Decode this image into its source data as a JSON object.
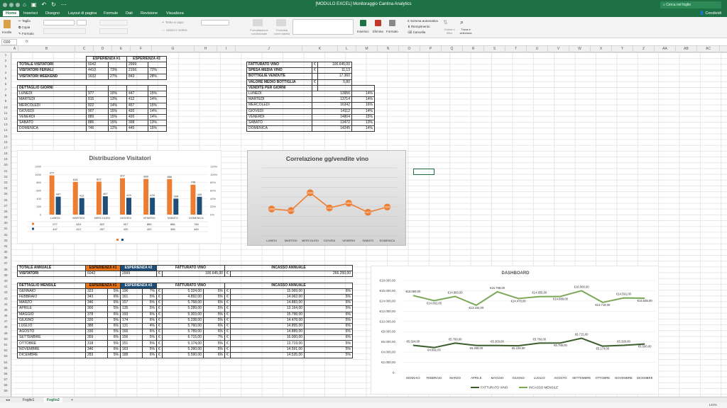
{
  "window": {
    "title": "[MODULO EXCEL] Monitoraggio Cantina Analytics",
    "search_placeholder": "Cerca nel foglio",
    "share_label": "Condividi"
  },
  "ribbon_tabs": [
    "Home",
    "Inserisci",
    "Disegno",
    "Layout di pagina",
    "Formule",
    "Dati",
    "Revisione",
    "Visualizza"
  ],
  "ribbon": {
    "paste": "Incolla",
    "cut": "Taglia",
    "copy": "Copia",
    "format_painter": "Formato",
    "wrap_text": "Testo a capo",
    "merge_center": "Unisci e centra",
    "conditional_format": "Formattazione condizionale",
    "format_as_table": "Formatta come tabella",
    "insert": "Inserisci",
    "delete": "Elimina",
    "format": "Formato",
    "autosum": "Somma automatica",
    "fill": "Riempimento",
    "clear": "Cancella",
    "sort_filter": "Ordina e filtra",
    "find_select": "Trova e seleziona"
  },
  "formula_bar": {
    "cell": "O20",
    "fx": "fx"
  },
  "columns": [
    "A",
    "B",
    "C",
    "D",
    "E",
    "F",
    "G",
    "H",
    "I",
    "J",
    "K",
    "L",
    "M",
    "N",
    "O",
    "P",
    "Q",
    "R",
    "S",
    "T",
    "U",
    "V",
    "W",
    "X",
    "Y",
    "Z",
    "AA",
    "AB",
    "AC"
  ],
  "visitor_table": {
    "h1": "ESPERIENZA #1",
    "h2": "ESPERIENZA #2",
    "totale": "TOTALE VISITATORI",
    "tot1": "6042",
    "tot2": "2999",
    "feriali": "VISITATORI FERIALI",
    "fer1": "4410",
    "fer1p": "73%",
    "fer2": "2156",
    "fer2p": "72%",
    "weekend": "VISITATORI WEEKEND",
    "wk1": "1632",
    "wk1p": "27%",
    "wk2": "843",
    "wk2p": "28%",
    "dettaglio": "DETTAGLIO GIORNI",
    "days": [
      [
        "LUNEDI",
        "977",
        "16%",
        "447",
        "15%"
      ],
      [
        "MARTEDI",
        "815",
        "13%",
        "412",
        "14%"
      ],
      [
        "MERCOLEDI",
        "822",
        "14%",
        "457",
        "15%"
      ],
      [
        "GIOVEDI",
        "907",
        "15%",
        "420",
        "14%"
      ],
      [
        "VENERDI",
        "889",
        "15%",
        "420",
        "14%"
      ],
      [
        "SABATO",
        "886",
        "15%",
        "398",
        "13%"
      ],
      [
        "DOMENICA",
        "746",
        "12%",
        "445",
        "15%"
      ]
    ]
  },
  "wine_table": {
    "fatturato": "FATTURATO VINO",
    "fatturato_cur": "€",
    "fatturato_val": "100.645,00",
    "spesa": "SPESA MEDIA VINO",
    "spesa_cur": "€",
    "spesa_val": "11,13",
    "bottiglie": "BOTTIGLIE VENDUTE",
    "bottiglie_val": "17.360",
    "valore": "VALORE MEDIO BOTTIGLIA",
    "valore_cur": "€",
    "valore_val": "5,80",
    "vendite": "VENDITE PER GIORNI",
    "days": [
      [
        "LUNEDI",
        "13956",
        "14%"
      ],
      [
        "MARTEDI",
        "13714",
        "14%"
      ],
      [
        "MERCOLEDI",
        "16342",
        "16%"
      ],
      [
        "GIOVEDI",
        "14112",
        "14%"
      ],
      [
        "VENERDI",
        "14804",
        "15%"
      ],
      [
        "SABATO",
        "13472",
        "13%"
      ],
      [
        "DOMENICA",
        "14245",
        "14%"
      ]
    ]
  },
  "annual_table": {
    "totale": "TOTALE ANNUALE",
    "esp1": "ESPERIENZA #1",
    "esp2": "ESPERIENZA #2",
    "fatturato": "FATTURATO VINO",
    "incasso": "INCASSO ANNUALE",
    "visitatori": "VISITATORI",
    "v1": "6042",
    "v2": "2999",
    "cur": "€",
    "fatt_val": "100.645,00",
    "inc_val": "266.250,00",
    "dettaglio": "DETTAGLIO MENSILE",
    "months": [
      [
        "GENNAIO",
        "323",
        "5%",
        "196",
        "7%",
        "5.324,00",
        "5%",
        "15.069,00",
        "6%"
      ],
      [
        "FEBBRAIO",
        "343",
        "6%",
        "161",
        "5%",
        "4.892,00",
        "5%",
        "14.062,00",
        "5%"
      ],
      [
        "MARZO",
        "346",
        "6%",
        "157",
        "5%",
        "5.768,00",
        "6%",
        "14.883,00",
        "6%"
      ],
      [
        "APRILE",
        "300",
        "5%",
        "135",
        "5%",
        "5.289,00",
        "5%",
        "13.164,00",
        "5%"
      ],
      [
        "MAGGIO",
        "378",
        "6%",
        "193",
        "6%",
        "5.303,00",
        "5%",
        "15.798,00",
        "6%"
      ],
      [
        "GIUGNO",
        "326",
        "5%",
        "174",
        "6%",
        "5.238,00",
        "5%",
        "14.478,00",
        "5%"
      ],
      [
        "LUGLIO",
        "388",
        "6%",
        "131",
        "4%",
        "5.760,00",
        "6%",
        "14.855,00",
        "6%"
      ],
      [
        "AGOSTO",
        "330",
        "5%",
        "166",
        "6%",
        "5.789,00",
        "6%",
        "14.889,00",
        "6%"
      ],
      [
        "SETTEMBRE",
        "359",
        "6%",
        "156",
        "5%",
        "6.715,00",
        "7%",
        "16.000,00",
        "6%"
      ],
      [
        "OTTOBRE",
        "318",
        "5%",
        "151",
        "5%",
        "5.174,00",
        "5%",
        "13.719,00",
        "5%"
      ],
      [
        "NOVEMBRE",
        "346",
        "6%",
        "163",
        "5%",
        "5.390,00",
        "5%",
        "14.591,00",
        "5%"
      ],
      [
        "DICEMBRE",
        "283",
        "5%",
        "188",
        "6%",
        "5.590,00",
        "6%",
        "14.535,00",
        "5%"
      ]
    ]
  },
  "chart_data": [
    {
      "type": "bar",
      "title": "Distribuzione Visitatori",
      "categories": [
        "LUNEDI",
        "MARTEDI",
        "MERCOLEDI",
        "GIOVEDI",
        "VENERDI",
        "SABATO",
        "DOMENICA"
      ],
      "series": [
        {
          "values": [
            977,
            815,
            822,
            907,
            889,
            886,
            746
          ],
          "color": "#ed7d31"
        },
        {
          "values": [
            447,
            412,
            457,
            420,
            420,
            398,
            445
          ],
          "color": "#1f4e79"
        }
      ],
      "ylim": [
        0,
        1200
      ],
      "yticks": [
        "0",
        "200",
        "400",
        "600",
        "800",
        "1000",
        "1200"
      ],
      "y2ticks": [
        "0%",
        "20%",
        "40%",
        "60%",
        "80%",
        "100%",
        "120%"
      ],
      "grid": true,
      "data_table": true
    },
    {
      "type": "line",
      "title": "Correlazione gg/vendite vino",
      "categories": [
        "LUNEDI",
        "MARTEDI",
        "MERCOLEDI",
        "GIOVEDI",
        "VENERDI",
        "SABATO",
        "DOMENICA"
      ],
      "series": [
        {
          "values": [
            13956,
            13714,
            16342,
            14112,
            14804,
            13472,
            14245
          ],
          "labels": [
            "13956",
            "13714",
            "16342",
            "14112",
            "14804",
            "13472",
            "14245"
          ],
          "color": "#ed7d31"
        }
      ],
      "grid": true
    },
    {
      "type": "line",
      "title": "DASHBOARD",
      "categories": [
        "GENNAIO",
        "FEBBRAIO",
        "MARZO",
        "APRILE",
        "MAGGIO",
        "GIUGNO",
        "LUGLIO",
        "AGOSTO",
        "SETTEMBRE",
        "OTTOBRE",
        "NOVEMBRE",
        "DICEMBRE"
      ],
      "series": [
        {
          "name": "FATTURATO VINO",
          "values": [
            5324,
            4892,
            5768,
            5289,
            5303,
            5238,
            5760,
            5789,
            6715,
            5174,
            5326,
            5590
          ],
          "labels": [
            "€5.324,00",
            "€4.892,00",
            "€5.768,00",
            "€5.289,00",
            "€5.303,00",
            "€5.238,00",
            "€5.760,00",
            "€5.789,00",
            "€6.715,00",
            "€5.174,00",
            "€5.326,00",
            "€5.590,00"
          ],
          "color": "#3b5e2b"
        },
        {
          "name": "INCASSO MENSILE",
          "values": [
            15069,
            14062,
            14883,
            13164,
            15798,
            14478,
            14855,
            14889,
            16000,
            13719,
            14591,
            14535
          ],
          "labels": [
            "€15.069,00",
            "€14.062,00",
            "€14.883,00",
            "€13.164,00",
            "€15.798,00",
            "€14.478,00",
            "€14.855,00",
            "€14.889,00",
            "€16.000,00",
            "€13.719,00",
            "€14.591,00",
            "€14.535,00"
          ],
          "color": "#7aa857"
        }
      ],
      "ylim": [
        0,
        18000
      ],
      "yticks": [
        "€-",
        "€2.000,00",
        "€4.000,00",
        "€6.000,00",
        "€8.000,00",
        "€10.000,00",
        "€12.000,00",
        "€14.000,00",
        "€16.000,00",
        "€18.000,00"
      ],
      "legend": "bottom",
      "grid": true
    }
  ],
  "sheets": [
    "Foglio1",
    "Foglio2"
  ],
  "active_sheet": "Foglio2",
  "zoom": "140%"
}
